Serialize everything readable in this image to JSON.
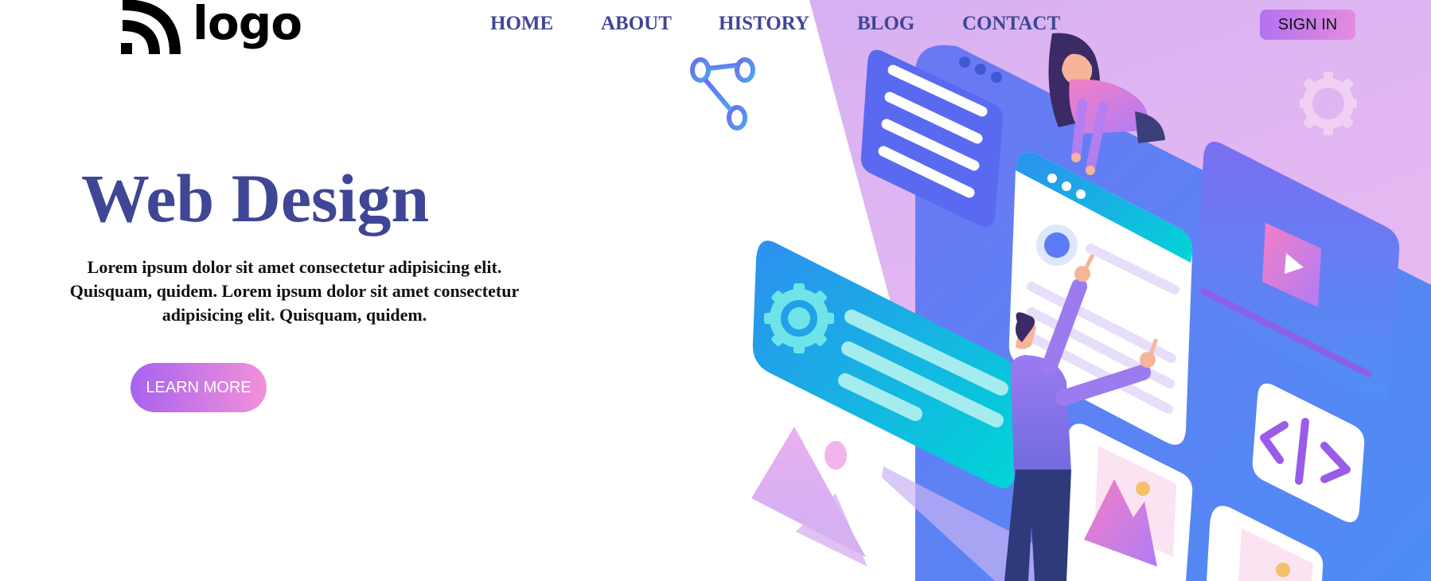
{
  "header": {
    "logo_text": "logo",
    "nav": [
      {
        "label": "HOME"
      },
      {
        "label": "ABOUT"
      },
      {
        "label": "HISTORY"
      },
      {
        "label": "BLOG"
      },
      {
        "label": "CONTACT"
      }
    ],
    "signin_label": "SIGN IN"
  },
  "hero": {
    "title": "Web Design",
    "body": "Lorem ipsum dolor sit amet consectetur adipisicing elit. Quisquam, quidem. Lorem ipsum dolor sit amet consectetur adipisicing elit. Quisquam, quidem.",
    "cta_label": "LEARN MORE"
  },
  "colors": {
    "accent_text": "#3f4696",
    "gradient_purple": "#a862ef",
    "gradient_pink": "#f291d9",
    "illustration_blue": "#5b7cf5"
  },
  "icons": {
    "logo_mark": "wifi-arcs-icon",
    "share": "share-nodes-icon",
    "gear": "gear-icon",
    "code": "code-brackets-icon",
    "image": "image-mountain-icon",
    "play": "play-icon"
  }
}
